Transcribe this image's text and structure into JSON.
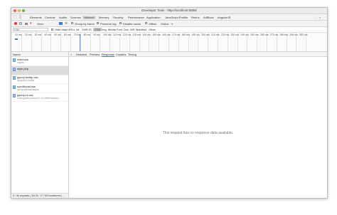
{
  "window": {
    "title": "Developer Tools - http://localhost:8888/"
  },
  "tabs": [
    "Elements",
    "Console",
    "Audits",
    "Sources",
    "Network",
    "Memory",
    "Security",
    "Performance",
    "Application",
    "JavaScript Profiler",
    "Redux",
    "AdBlock",
    "AngularJS"
  ],
  "active_tab": "Network",
  "toolbar": {
    "view_label": "View:",
    "group_by_frame": "Group by frame",
    "preserve_log": "Preserve log",
    "disable_cache": "Disable cache",
    "offline": "Offline",
    "throttle": "Online"
  },
  "filter": {
    "placeholder": "Filter",
    "hide_data_urls": "Hide data URLs",
    "types": [
      "All",
      "XHR",
      "JS",
      "CSS",
      "Img",
      "Media",
      "Font",
      "Doc",
      "WS",
      "Manifest",
      "Other"
    ],
    "active_type": "CSS"
  },
  "timeline": {
    "ticks": [
      "10 ms",
      "20 ms",
      "30 ms",
      "40 ms",
      "50 ms",
      "60 ms",
      "70 ms",
      "80 ms",
      "90 ms",
      "100 ms",
      "110 ms",
      "120 ms",
      "130 ms",
      "140 ms",
      "150 ms",
      "160 ms",
      "170 ms",
      "180 ms",
      "190 ms",
      "200 ms",
      "210 ms",
      "220 ms",
      "230 ms",
      "240 ms",
      "250 ms",
      "260 ms",
      "270 ms",
      "280 ms",
      "290 ms",
      "300 ms"
    ]
  },
  "requests": {
    "header": "Name",
    "items": [
      {
        "name": "reset.css",
        "path": "/styles"
      },
      {
        "name": "style.php",
        "path": "",
        "selected": true
      },
      {
        "name": "jquery.tooltip.css",
        "path": "/js/jquery.tooltip"
      },
      {
        "name": "nyroModal.css",
        "path": "/js/nyroModal/styles"
      },
      {
        "name": "jquery-ui.css",
        "path": "code.jquery.com/ui/1.10.4/themes/sm..."
      }
    ],
    "status": "5 / 36 requests | 344 B / 177 KB transferred | ..."
  },
  "detail": {
    "close": "×",
    "tabs": [
      "Headers",
      "Preview",
      "Response",
      "Cookies",
      "Timing"
    ],
    "active_tab": "Response",
    "empty_message": "This request has no response data available."
  }
}
